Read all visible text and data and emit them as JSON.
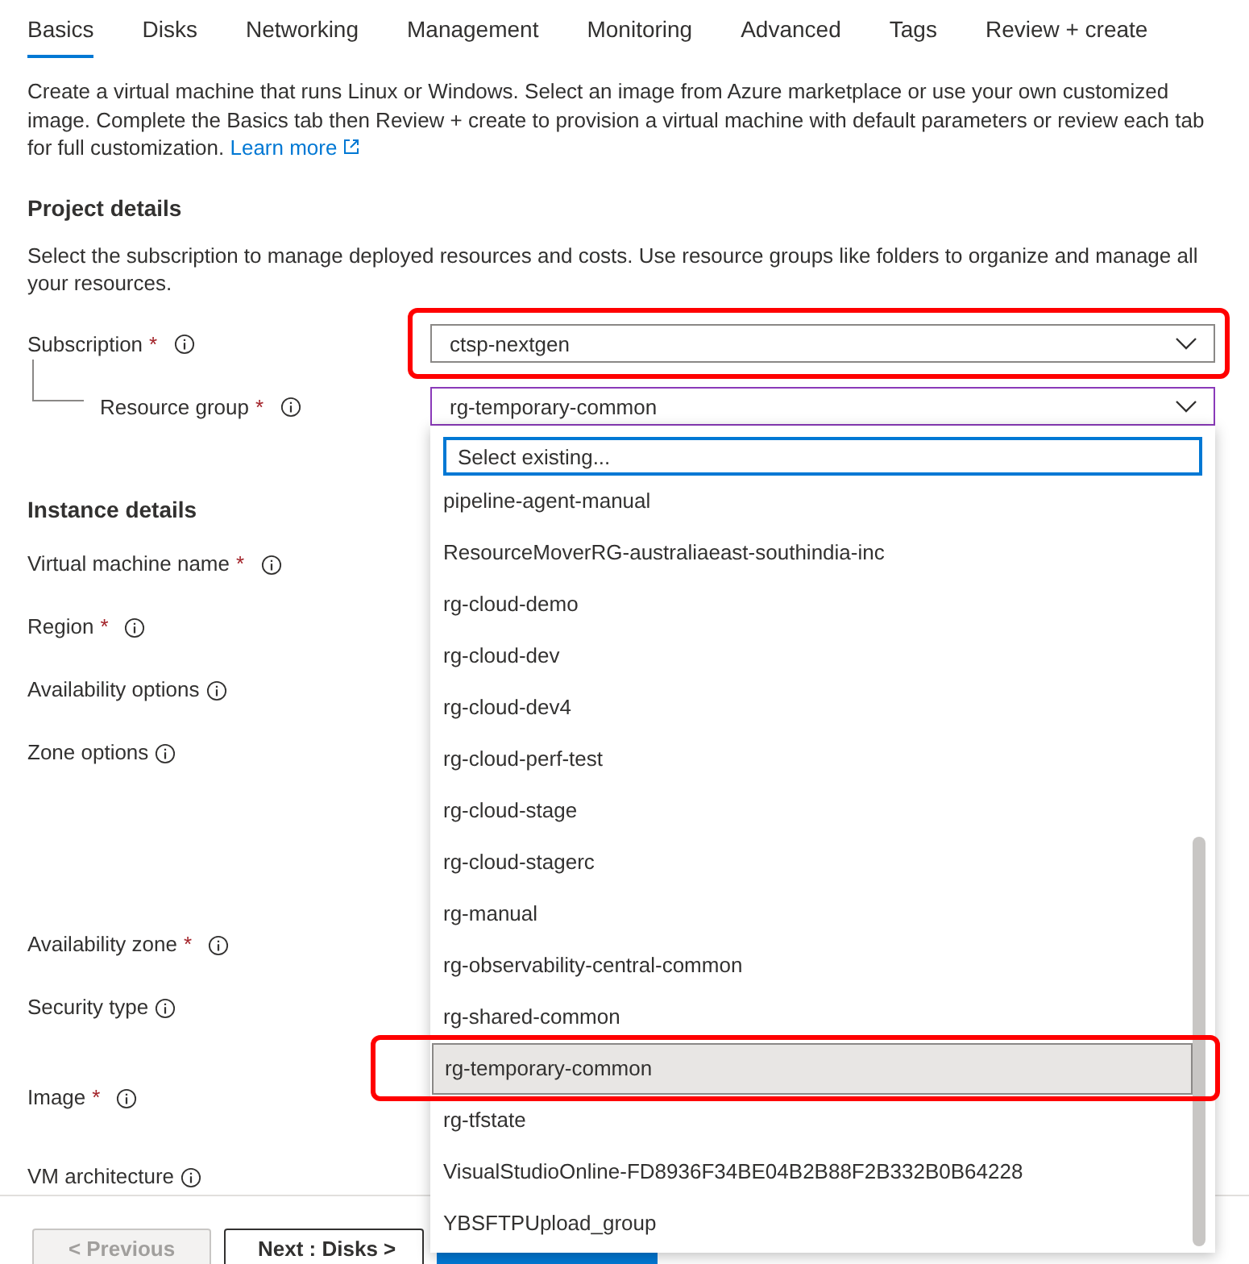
{
  "tabs": [
    {
      "label": "Basics",
      "selected": true
    },
    {
      "label": "Disks",
      "selected": false
    },
    {
      "label": "Networking",
      "selected": false
    },
    {
      "label": "Management",
      "selected": false
    },
    {
      "label": "Monitoring",
      "selected": false
    },
    {
      "label": "Advanced",
      "selected": false
    },
    {
      "label": "Tags",
      "selected": false
    },
    {
      "label": "Review + create",
      "selected": false
    }
  ],
  "intro": {
    "text": "Create a virtual machine that runs Linux or Windows. Select an image from Azure marketplace or use your own customized image. Complete the Basics tab then Review + create to provision a virtual machine with default parameters or review each tab for full customization.",
    "link": "Learn more"
  },
  "required_marker": "*",
  "project_details": {
    "heading": "Project details",
    "description": "Select the subscription to manage deployed resources and costs. Use resource groups like folders to organize and manage all your resources.",
    "fields": [
      {
        "label": "Subscription",
        "required": true,
        "value": "ctsp-nextgen",
        "highlighted": true,
        "focused": false,
        "nested": false
      },
      {
        "label": "Resource group",
        "required": true,
        "value": "rg-temporary-common",
        "highlighted": false,
        "focused": true,
        "nested": true
      }
    ]
  },
  "instance_details": {
    "heading": "Instance details",
    "fields": [
      {
        "label": "Virtual machine name",
        "required": true
      },
      {
        "label": "Region",
        "required": true
      },
      {
        "label": "Availability options",
        "required": false
      },
      {
        "label": "Zone options",
        "required": false
      },
      {
        "label": "Availability zone",
        "required": true
      },
      {
        "label": "Security type",
        "required": false
      },
      {
        "label": "Image",
        "required": true
      },
      {
        "label": "VM architecture",
        "required": false
      }
    ]
  },
  "dropdown": {
    "placeholder": "Select existing...",
    "items": [
      {
        "label": "pipeline-agent-manual",
        "selected": false,
        "highlighted": false
      },
      {
        "label": "ResourceMoverRG-australiaeast-southindia-inc",
        "selected": false,
        "highlighted": false
      },
      {
        "label": "rg-cloud-demo",
        "selected": false,
        "highlighted": false
      },
      {
        "label": "rg-cloud-dev",
        "selected": false,
        "highlighted": false
      },
      {
        "label": "rg-cloud-dev4",
        "selected": false,
        "highlighted": false
      },
      {
        "label": "rg-cloud-perf-test",
        "selected": false,
        "highlighted": false
      },
      {
        "label": "rg-cloud-stage",
        "selected": false,
        "highlighted": false
      },
      {
        "label": "rg-cloud-stagerc",
        "selected": false,
        "highlighted": false
      },
      {
        "label": "rg-manual",
        "selected": false,
        "highlighted": false
      },
      {
        "label": "rg-observability-central-common",
        "selected": false,
        "highlighted": false
      },
      {
        "label": "rg-shared-common",
        "selected": false,
        "highlighted": false
      },
      {
        "label": "rg-temporary-common",
        "selected": true,
        "highlighted": true
      },
      {
        "label": "rg-tfstate",
        "selected": false,
        "highlighted": false
      },
      {
        "label": "VisualStudioOnline-FD8936F34BE04B2B88F2B332B0B64228",
        "selected": false,
        "highlighted": false
      },
      {
        "label": "YBSFTPUpload_group",
        "selected": false,
        "highlighted": false
      }
    ]
  },
  "footer": {
    "buttons": [
      {
        "label": "< Previous",
        "kind": "disabled"
      },
      {
        "label": "Next : Disks >",
        "kind": "secondary"
      },
      {
        "kind": "primary"
      }
    ]
  }
}
